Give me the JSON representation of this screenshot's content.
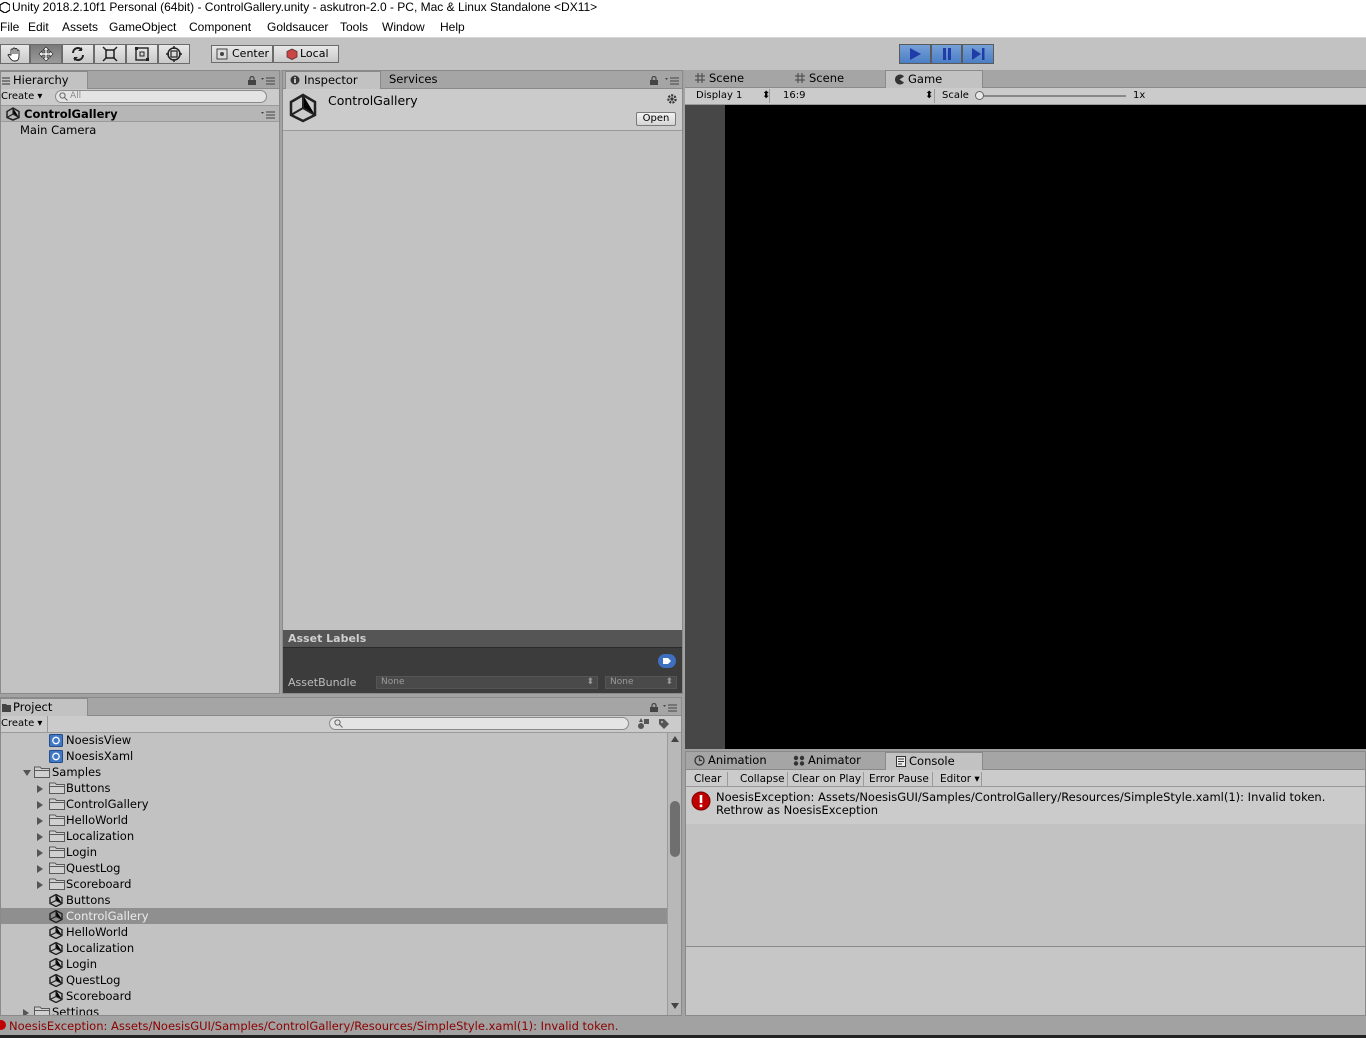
{
  "window": {
    "title": "Unity 2018.2.10f1 Personal (64bit) - ControlGallery.unity - askutron-2.0 - PC, Mac & Linux Standalone <DX11>"
  },
  "menu": [
    "File",
    "Edit",
    "Assets",
    "GameObject",
    "Component",
    "Goldsaucer",
    "Tools",
    "Window",
    "Help"
  ],
  "toolbar": {
    "tools": [
      "hand-icon",
      "move-icon",
      "rotate-icon",
      "scale-icon",
      "rect-icon",
      "transform-icon"
    ],
    "pivot_center": "Center",
    "pivot_local": "Local"
  },
  "hierarchy": {
    "tab": "Hierarchy",
    "create": "Create",
    "search_placeholder": "All",
    "scene": "ControlGallery",
    "items": [
      "Main Camera"
    ]
  },
  "inspector": {
    "tabs": [
      "Inspector",
      "Services"
    ],
    "asset_name": "ControlGallery",
    "open_button": "Open",
    "asset_labels": "Asset Labels",
    "asset_bundle_label": "AssetBundle",
    "asset_bundle_value": "None",
    "asset_bundle_variant": "None"
  },
  "viewport": {
    "tabs": [
      "Scene",
      "Scene",
      "Game"
    ],
    "display": "Display 1",
    "aspect": "16:9",
    "scale_label": "Scale",
    "scale_value": "1x"
  },
  "project": {
    "tab": "Project",
    "create": "Create",
    "tree": [
      {
        "label": "NoesisView",
        "type": "script"
      },
      {
        "label": "NoesisXaml",
        "type": "script"
      },
      {
        "label": "Samples",
        "type": "folder-open"
      },
      {
        "label": "Buttons",
        "type": "folder"
      },
      {
        "label": "ControlGallery",
        "type": "folder"
      },
      {
        "label": "HelloWorld",
        "type": "folder"
      },
      {
        "label": "Localization",
        "type": "folder"
      },
      {
        "label": "Login",
        "type": "folder"
      },
      {
        "label": "QuestLog",
        "type": "folder"
      },
      {
        "label": "Scoreboard",
        "type": "folder"
      },
      {
        "label": "Buttons",
        "type": "scene"
      },
      {
        "label": "ControlGallery",
        "type": "scene",
        "selected": true
      },
      {
        "label": "HelloWorld",
        "type": "scene"
      },
      {
        "label": "Localization",
        "type": "scene"
      },
      {
        "label": "Login",
        "type": "scene"
      },
      {
        "label": "QuestLog",
        "type": "scene"
      },
      {
        "label": "Scoreboard",
        "type": "scene"
      },
      {
        "label": "Settings",
        "type": "folder"
      }
    ]
  },
  "console": {
    "tabs": [
      "Animation",
      "Animator",
      "Console"
    ],
    "buttons": [
      "Clear",
      "Collapse",
      "Clear on Play",
      "Error Pause",
      "Editor"
    ],
    "message_line1": "NoesisException: Assets/NoesisGUI/Samples/ControlGallery/Resources/SimpleStyle.xaml(1): Invalid token.",
    "message_line2": "Rethrow as NoesisException"
  },
  "statusbar": {
    "text": "NoesisException: Assets/NoesisGUI/Samples/ControlGallery/Resources/SimpleStyle.xaml(1): Invalid token."
  },
  "colors": {
    "panel": "#c2c2c2",
    "tabstrip": "#a5a5a5",
    "game_view": "#000000",
    "selected_row": "#8f8f8f",
    "error_red": "#c00000",
    "play_blue": "#4a7ec4"
  }
}
